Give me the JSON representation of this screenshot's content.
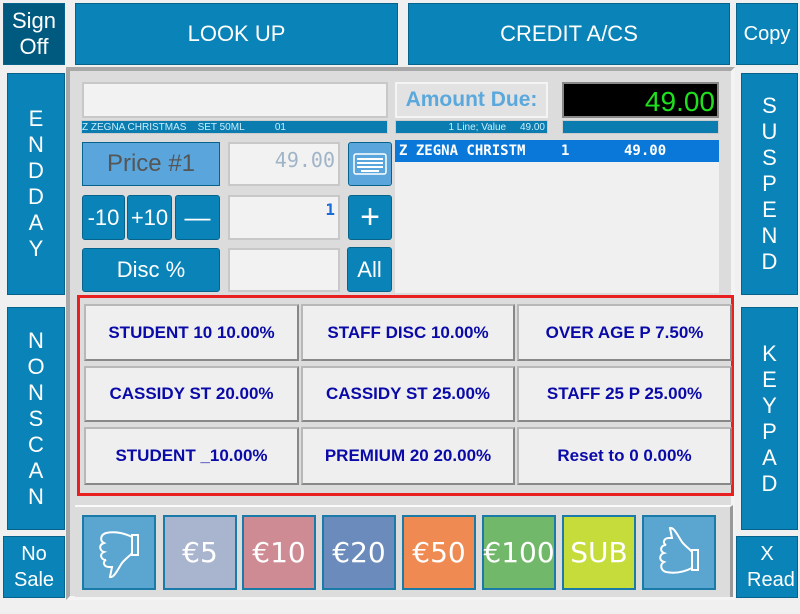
{
  "top": {
    "sign_off": "Sign Off",
    "look_up": "LOOK UP",
    "credit": "CREDIT A/CS",
    "copy": "Copy"
  },
  "left": {
    "end_day": "END DAY",
    "non_scan": "NON SCAN",
    "no_sale": "No Sale"
  },
  "right": {
    "suspend": "SUSPEND",
    "keypad": "KEYPAD",
    "x_read": "X Read"
  },
  "display": {
    "input": "",
    "item_info": "Z ZEGNA CHRISTMAS    SET 50ML           01",
    "amount_due_label": "Amount Due:",
    "amount_due": "49.00",
    "summary": "1 Line; Value     49.00"
  },
  "lines": [
    {
      "desc": "Z ZEGNA CHRISTM",
      "qty": "1",
      "price": "49.00"
    }
  ],
  "controls": {
    "price_label": "Price #1",
    "price_value": "49.00",
    "minus10": "-10",
    "plus10": "+10",
    "minus": "—",
    "qty": "1",
    "plus": "+",
    "disc_label": "Disc %",
    "disc_value": "",
    "all": "All"
  },
  "discounts": [
    "STUDENT 10 10.00%",
    "STAFF DISC 10.00%",
    "OVER AGE P 7.50%",
    "CASSIDY ST 20.00%",
    "CASSIDY ST 25.00%",
    "STAFF 25 P 25.00%",
    "STUDENT _10.00%",
    "PREMIUM 20 20.00%",
    "Reset to 0 0.00%"
  ],
  "tender": [
    {
      "label": "€5",
      "color": "#a9b4cf"
    },
    {
      "label": "€10",
      "color": "#cf8b94"
    },
    {
      "label": "€20",
      "color": "#6a8bbb"
    },
    {
      "label": "€50",
      "color": "#ef8a52"
    },
    {
      "label": "€100",
      "color": "#72b86a"
    },
    {
      "label": "SUB",
      "color": "#c6dc3a"
    }
  ],
  "icons": {
    "reject": "thumbs-down-icon",
    "accept": "thumbs-up-icon",
    "keyboard": "keyboard-icon"
  }
}
